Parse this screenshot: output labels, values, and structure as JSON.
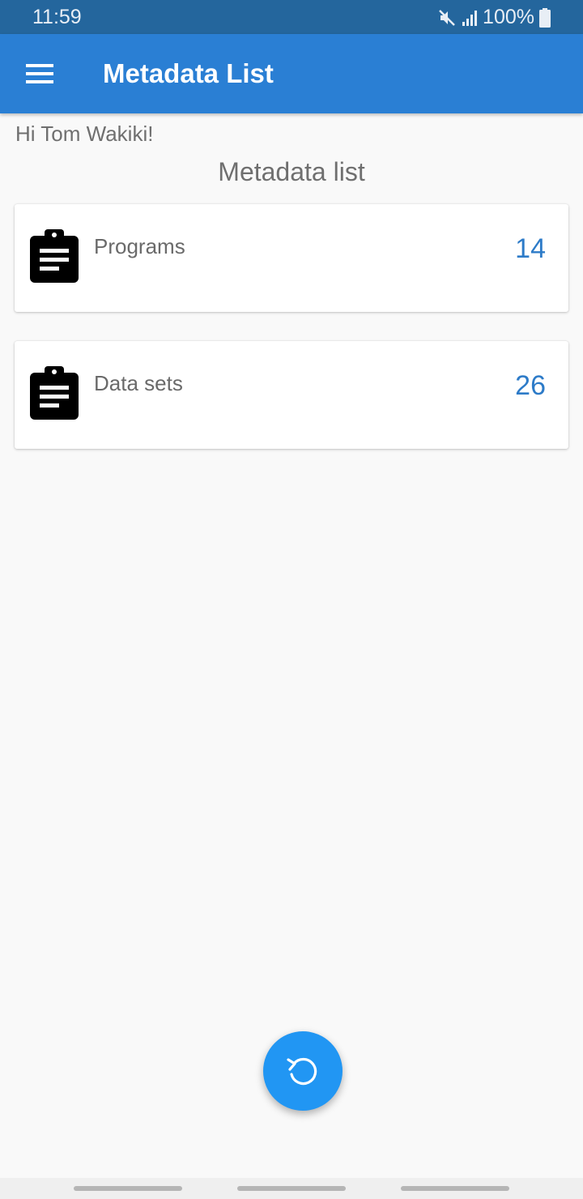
{
  "status_bar": {
    "time": "11:59",
    "battery": "100%",
    "icons": [
      "mute-icon",
      "signal-icon",
      "battery-icon"
    ]
  },
  "app_bar": {
    "title": "Metadata List",
    "icon": "menu-icon",
    "color": "#2a7fd4"
  },
  "main": {
    "greeting": "Hi Tom Wakiki!",
    "section_title": "Metadata list",
    "items": [
      {
        "label": "Programs",
        "count": "14",
        "icon": "clipboard-icon"
      },
      {
        "label": "Data sets",
        "count": "26",
        "icon": "clipboard-icon"
      }
    ]
  },
  "fab": {
    "icon": "refresh-icon",
    "color": "#2196f3"
  },
  "nav_bar": {
    "buttons": [
      "recent-apps",
      "home",
      "back"
    ]
  }
}
